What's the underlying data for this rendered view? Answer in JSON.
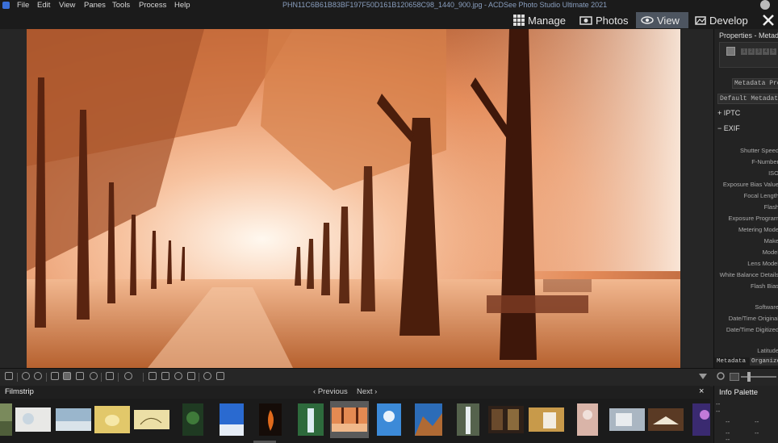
{
  "menubar": {
    "items": [
      "File",
      "Edit",
      "View",
      "Panes",
      "Tools",
      "Process",
      "Help"
    ],
    "window_title": "PHN11C6B61B83BF197F50D161B120658C98_1440_900.jpg - ACDSee Photo Studio Ultimate 2021"
  },
  "modes": {
    "manage": "Manage",
    "photos": "Photos",
    "view": "View",
    "develop": "Develop"
  },
  "properties": {
    "title": "Properties - Metadata",
    "ratings": [
      "1",
      "2",
      "3",
      "4",
      "5"
    ],
    "metadata_preset_btn": "Metadata Presets",
    "default_metadata": "Default Metadata",
    "iptc": "+ IPTC",
    "exif": "− EXIF",
    "exif_fields": [
      "Shutter Speed",
      "F-Number",
      "ISO",
      "Exposure Bias Value",
      "Focal Length",
      "Flash",
      "Exposure Program",
      "Metering Mode",
      "Make",
      "Model",
      "Lens Model",
      "White Balance Details",
      "Flash Bias",
      "Software",
      "Date/Time Original",
      "Date/Time Digitized",
      "Latitude"
    ],
    "tabs": [
      "Metadata",
      "Organize"
    ]
  },
  "filmstrip": {
    "label": "Filmstrip",
    "previous": "Previous",
    "next": "Next",
    "close": "×"
  },
  "info_palette": {
    "title": "Info Palette",
    "values": [
      "--",
      "--",
      "--",
      "--",
      "--",
      "--",
      "--"
    ]
  },
  "colors": {
    "accent_active_mode": "#4d5560",
    "photo_warm": "#e8874e"
  }
}
